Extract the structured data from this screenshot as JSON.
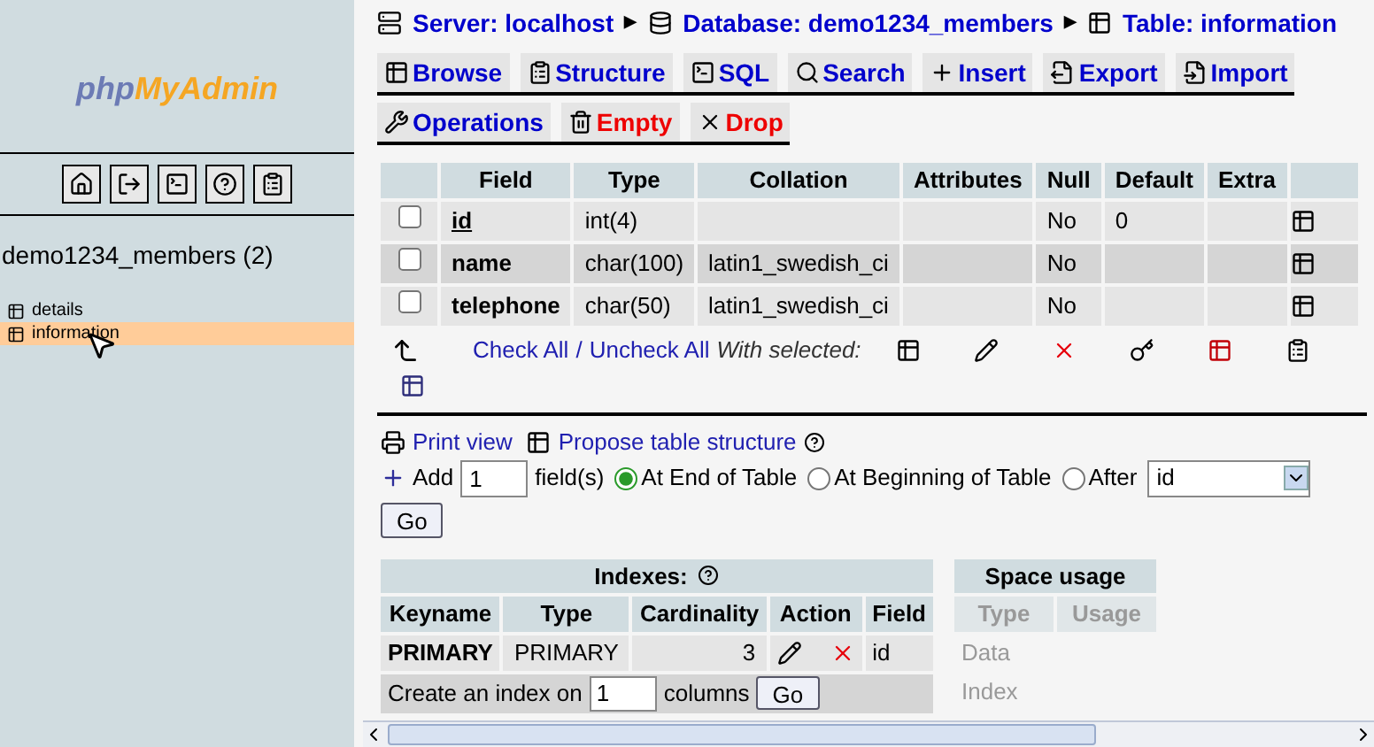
{
  "sidebar": {
    "logo": {
      "part_1": "php",
      "part_2": "MyAdmin"
    },
    "db_title": "demo1234_members (2)",
    "tables": [
      {
        "label": "details",
        "selected": false
      },
      {
        "label": "information",
        "selected": true
      }
    ]
  },
  "breadcrumb": [
    {
      "kind": "server",
      "label": "Server: localhost"
    },
    {
      "kind": "database",
      "label": "Database: demo1234_members",
      "arrow": "▶"
    },
    {
      "kind": "table",
      "label": "Table: information",
      "arrow": "▶"
    }
  ],
  "tabs": [
    [
      {
        "kind": "browse",
        "label": "Browse",
        "color": "#0000cc"
      },
      {
        "kind": "structure",
        "label": "Structure",
        "color": "#0000cc"
      },
      {
        "kind": "sql",
        "label": "SQL",
        "color": "#0000cc"
      },
      {
        "kind": "search",
        "label": "Search",
        "color": "#0000cc"
      },
      {
        "kind": "insert",
        "label": "Insert",
        "color": "#0000cc"
      },
      {
        "kind": "export",
        "label": "Export",
        "color": "#0000cc"
      },
      {
        "kind": "import",
        "label": "Import",
        "color": "#0000cc"
      }
    ],
    [
      {
        "kind": "operations",
        "label": "Operations",
        "color": "#0000cc"
      },
      {
        "kind": "empty",
        "label": "Empty",
        "color": "#ee0000"
      },
      {
        "kind": "drop",
        "label": "Drop",
        "color": "#ee0000"
      }
    ]
  ],
  "fields_table": {
    "columns": [
      "Field",
      "Type",
      "Collation",
      "Attributes",
      "Null",
      "Default",
      "Extra"
    ],
    "rows": [
      {
        "checked": false,
        "primary": true,
        "cells": [
          "id",
          "int(4)",
          "",
          "",
          "No",
          "0",
          ""
        ]
      },
      {
        "checked": false,
        "primary": false,
        "cells": [
          "name",
          "char(100)",
          "latin1_swedish_ci",
          "",
          "No",
          "",
          ""
        ]
      },
      {
        "checked": false,
        "primary": false,
        "cells": [
          "telephone",
          "char(50)",
          "latin1_swedish_ci",
          "",
          "No",
          "",
          ""
        ]
      }
    ],
    "check_all": "Check All",
    "separator": "/",
    "uncheck_all": "Uncheck All",
    "with_selected": "With selected:"
  },
  "print_view": "Print view",
  "propose": "Propose table structure",
  "add_fields": {
    "label": "Add",
    "value": "1",
    "unit": "field(s)",
    "positions": [
      {
        "label": "At End of Table",
        "selected": true
      },
      {
        "label": "At Beginning of Table",
        "selected": false
      },
      {
        "label": "After",
        "selected": false
      }
    ],
    "after_value": "id",
    "go": "Go"
  },
  "indexes": {
    "title": "Indexes:",
    "columns": [
      "Keyname",
      "Type",
      "Cardinality",
      "Action",
      "Field"
    ],
    "rows": [
      {
        "keyname": "PRIMARY",
        "type": "PRIMARY",
        "cardinality": "3",
        "field": "id"
      }
    ],
    "create_label": "Create an index on",
    "create_value": "1",
    "create_unit": "columns",
    "go": "Go"
  },
  "space_usage": {
    "title": "Space usage",
    "columns": [
      "Type",
      "Usage"
    ],
    "rows": [
      "Data",
      "Index"
    ]
  }
}
